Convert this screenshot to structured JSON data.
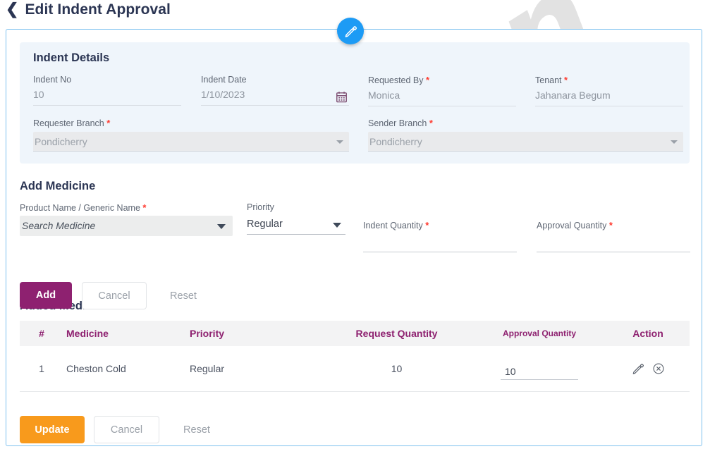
{
  "header": {
    "back_icon": "chevron-left-icon",
    "title": "Edit Indent Approval"
  },
  "watermark": {
    "text": "Ezovion"
  },
  "fab": {
    "icon": "pencil-icon",
    "color": "#1d9bf5"
  },
  "indent_details": {
    "title": "Indent Details",
    "fields": [
      {
        "label": "Indent No",
        "required": false,
        "value": "10",
        "type": "text"
      },
      {
        "label": "Indent Date",
        "required": false,
        "value": "1/10/2023",
        "type": "date",
        "icon": "calendar-icon"
      },
      {
        "label": "Requested By",
        "required": true,
        "value": "Monica",
        "type": "text"
      },
      {
        "label": "Tenant",
        "required": true,
        "value": "Jahanara Begum",
        "type": "text"
      },
      {
        "label": "Requester Branch",
        "required": true,
        "value": "Pondicherry",
        "type": "select",
        "disabled": true
      },
      {
        "label": "Sender Branch",
        "required": true,
        "value": "Pondicherry",
        "type": "select",
        "disabled": true
      }
    ]
  },
  "add_medicine": {
    "title": "Add Medicine",
    "product_label": "Product Name / Generic Name",
    "product_placeholder": "Search Medicine",
    "priority_label": "Priority",
    "priority_value": "Regular",
    "indent_qty_label": "Indent Quantity",
    "indent_qty_value": "",
    "approval_qty_label": "Approval Quantity",
    "approval_qty_value": "",
    "buttons": {
      "add": "Add",
      "cancel": "Cancel",
      "reset": "Reset"
    }
  },
  "added_medicine": {
    "title": "Added Medicine",
    "columns": [
      "#",
      "Medicine",
      "Priority",
      "Request Quantity",
      "Approval Quantity",
      "Action"
    ],
    "rows": [
      {
        "index": "1",
        "medicine": "Cheston Cold",
        "priority": "Regular",
        "request_quantity": "10",
        "approval_quantity": "10",
        "actions": [
          "pencil-icon",
          "circle-x-icon"
        ]
      }
    ]
  },
  "footer": {
    "buttons": {
      "update": "Update",
      "cancel": "Cancel",
      "reset": "Reset"
    }
  },
  "colors": {
    "accent_purple": "#8e2170",
    "accent_orange": "#f89a1c",
    "accent_blue": "#1d9bf5",
    "panel_bg": "#eff5fb",
    "required_star": "#ff3b30",
    "title_navy": "#2b3553"
  }
}
